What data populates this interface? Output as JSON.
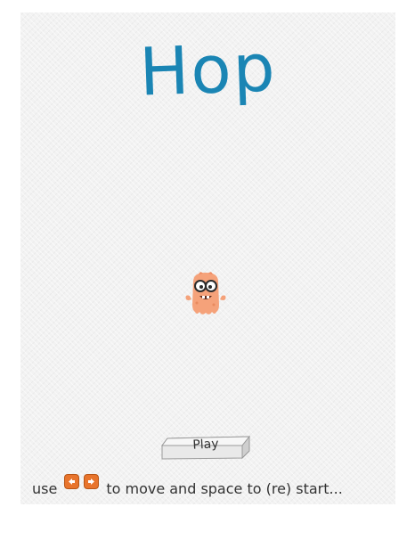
{
  "game": {
    "title": "Hop",
    "play_label": "Play",
    "instructions": {
      "prefix": "use",
      "suffix": "to move and space to (re) start..."
    },
    "keys": [
      "left-arrow-key-icon",
      "right-arrow-key-icon"
    ],
    "character": "monster-character-icon"
  },
  "colors": {
    "title": "#1a85b4",
    "monster": "#f5a27a",
    "key": "#e8742c"
  }
}
